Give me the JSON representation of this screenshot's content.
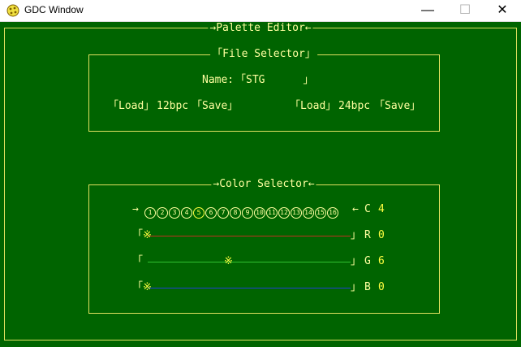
{
  "window": {
    "title": "GDC Window",
    "minimize_glyph": "—",
    "maximize_glyph": "☐",
    "close_glyph": "✕"
  },
  "palette_editor": {
    "title": "→Palette Editor←"
  },
  "file_selector": {
    "title": "「File Selector」",
    "name_label": "Name:",
    "name_value": "「STG      」",
    "load_12": "「Load」",
    "label_12": "12bpc",
    "save_12": "「Save」",
    "load_24": "「Load」",
    "label_24": "24bpc",
    "save_24": "「Save」"
  },
  "color_selector": {
    "title": "→Color Selector←",
    "left_arrow": "→",
    "right_arrow": "←",
    "colors": [
      "1",
      "2",
      "3",
      "4",
      "5",
      "6",
      "7",
      "8",
      "9",
      "10",
      "11",
      "12",
      "13",
      "14",
      "15",
      "16"
    ],
    "selected_color": "5",
    "color_label": "C",
    "color_value": "4",
    "knob_glyph": "※",
    "open_bracket": "「",
    "close_bracket": "」",
    "channels": [
      {
        "label": "R",
        "value": "0",
        "level": 0,
        "color": "#c03020"
      },
      {
        "label": "G",
        "value": "6",
        "level": 0.4,
        "color": "#30c030"
      },
      {
        "label": "B",
        "value": "0",
        "level": 0,
        "color": "#2040d0"
      }
    ]
  }
}
